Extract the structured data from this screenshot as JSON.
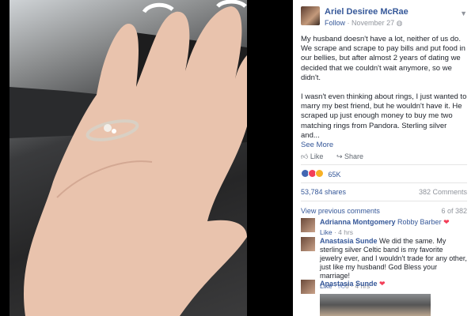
{
  "post": {
    "author": "Ariel Desiree McRae",
    "follow": "Follow",
    "date": "November 27",
    "separator": "·",
    "paragraph1": "My husband doesn't have a lot, neither of us do. We scrape and scrape to pay bills and put food in our bellies, but after almost 2 years of dating we decided that we couldn't wait anymore, so we didn't.",
    "paragraph2": "I wasn't even thinking about rings, I just wanted to marry my best friend, but he wouldn't have it. He scraped up just enough money to buy me two matching rings from Pandora. Sterling silver and...",
    "see_more": "See More",
    "like_label": "Like",
    "share_label": "Share",
    "reaction_count": "65K",
    "shares": "53,784 shares",
    "comments": "382 Comments",
    "view_previous": "View previous comments",
    "pagination": "6 of 382"
  },
  "comments": [
    {
      "name": "Adrianna Montgomery",
      "tag": "Robby Barber",
      "text": "",
      "like": "Like",
      "time": "4 hrs",
      "likes": "",
      "heart": true
    },
    {
      "name": "Anastasia Sunde",
      "tag": "",
      "text": "We did the same. My sterling silver Celtic band is my favorite jewelry ever, and I wouldn't trade for any other, just like my husband! God Bless your marriage!",
      "like": "Like",
      "time": "4 hrs",
      "likes": "6",
      "heart": false
    },
    {
      "name": "Anastasia Sunde",
      "tag": "",
      "text": "",
      "like": "",
      "time": "",
      "likes": "",
      "heart": true
    }
  ],
  "icons": {
    "chevron": "chevron-down-icon",
    "like": "thumbs-up-icon",
    "share": "share-arrow-icon",
    "heart": "heart-icon"
  },
  "colors": {
    "link": "#365899",
    "meta": "#90949c",
    "heart": "#f33e58",
    "like_blue": "#4267b2"
  }
}
